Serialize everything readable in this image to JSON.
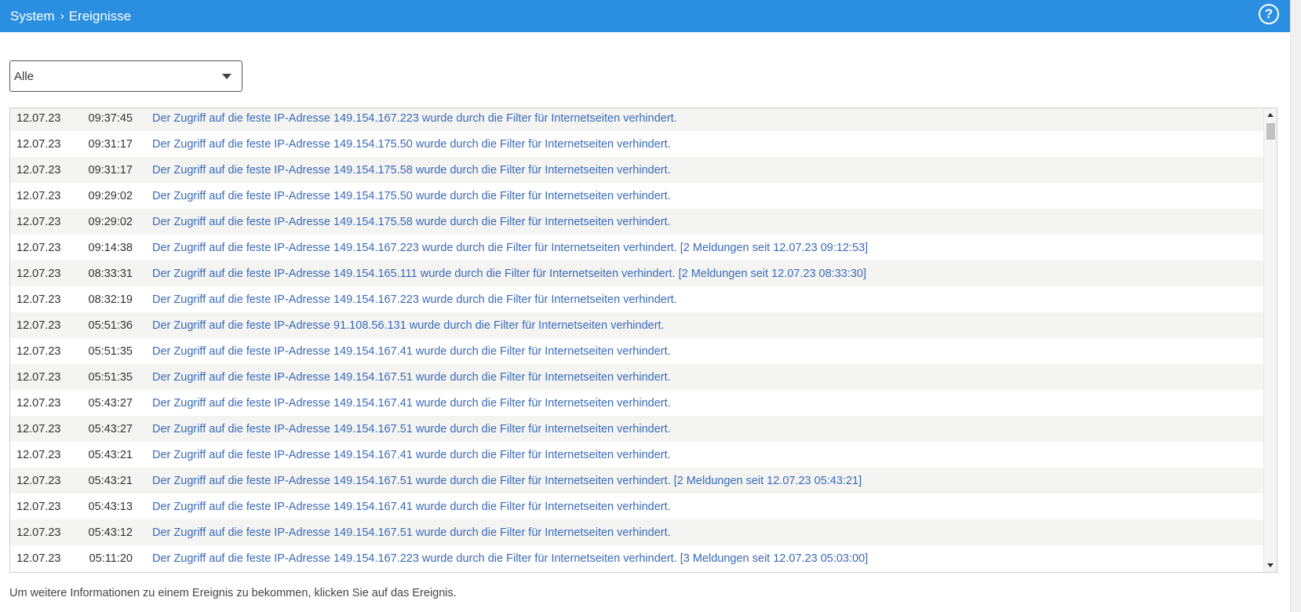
{
  "header": {
    "breadcrumb": [
      "System",
      "Ereignisse"
    ],
    "separator": "›",
    "help_label": "?"
  },
  "filter": {
    "selected": "Alle"
  },
  "events": [
    {
      "date": "12.07.23",
      "time": "09:37:45",
      "message": "Der Zugriff auf die feste IP-Adresse 149.154.167.223 wurde durch die Filter für Internetseiten verhindert."
    },
    {
      "date": "12.07.23",
      "time": "09:31:17",
      "message": "Der Zugriff auf die feste IP-Adresse 149.154.175.50 wurde durch die Filter für Internetseiten verhindert."
    },
    {
      "date": "12.07.23",
      "time": "09:31:17",
      "message": "Der Zugriff auf die feste IP-Adresse 149.154.175.58 wurde durch die Filter für Internetseiten verhindert."
    },
    {
      "date": "12.07.23",
      "time": "09:29:02",
      "message": "Der Zugriff auf die feste IP-Adresse 149.154.175.50 wurde durch die Filter für Internetseiten verhindert."
    },
    {
      "date": "12.07.23",
      "time": "09:29:02",
      "message": "Der Zugriff auf die feste IP-Adresse 149.154.175.58 wurde durch die Filter für Internetseiten verhindert."
    },
    {
      "date": "12.07.23",
      "time": "09:14:38",
      "message": "Der Zugriff auf die feste IP-Adresse 149.154.167.223 wurde durch die Filter für Internetseiten verhindert. [2 Meldungen seit 12.07.23 09:12:53]"
    },
    {
      "date": "12.07.23",
      "time": "08:33:31",
      "message": "Der Zugriff auf die feste IP-Adresse 149.154.165.111 wurde durch die Filter für Internetseiten verhindert. [2 Meldungen seit 12.07.23 08:33:30]"
    },
    {
      "date": "12.07.23",
      "time": "08:32:19",
      "message": "Der Zugriff auf die feste IP-Adresse 149.154.167.223 wurde durch die Filter für Internetseiten verhindert."
    },
    {
      "date": "12.07.23",
      "time": "05:51:36",
      "message": "Der Zugriff auf die feste IP-Adresse 91.108.56.131 wurde durch die Filter für Internetseiten verhindert."
    },
    {
      "date": "12.07.23",
      "time": "05:51:35",
      "message": "Der Zugriff auf die feste IP-Adresse 149.154.167.41 wurde durch die Filter für Internetseiten verhindert."
    },
    {
      "date": "12.07.23",
      "time": "05:51:35",
      "message": "Der Zugriff auf die feste IP-Adresse 149.154.167.51 wurde durch die Filter für Internetseiten verhindert."
    },
    {
      "date": "12.07.23",
      "time": "05:43:27",
      "message": "Der Zugriff auf die feste IP-Adresse 149.154.167.41 wurde durch die Filter für Internetseiten verhindert."
    },
    {
      "date": "12.07.23",
      "time": "05:43:27",
      "message": "Der Zugriff auf die feste IP-Adresse 149.154.167.51 wurde durch die Filter für Internetseiten verhindert."
    },
    {
      "date": "12.07.23",
      "time": "05:43:21",
      "message": "Der Zugriff auf die feste IP-Adresse 149.154.167.41 wurde durch die Filter für Internetseiten verhindert."
    },
    {
      "date": "12.07.23",
      "time": "05:43:21",
      "message": "Der Zugriff auf die feste IP-Adresse 149.154.167.51 wurde durch die Filter für Internetseiten verhindert. [2 Meldungen seit 12.07.23 05:43:21]"
    },
    {
      "date": "12.07.23",
      "time": "05:43:13",
      "message": "Der Zugriff auf die feste IP-Adresse 149.154.167.41 wurde durch die Filter für Internetseiten verhindert."
    },
    {
      "date": "12.07.23",
      "time": "05:43:12",
      "message": "Der Zugriff auf die feste IP-Adresse 149.154.167.51 wurde durch die Filter für Internetseiten verhindert."
    },
    {
      "date": "12.07.23",
      "time": "05:11:20",
      "message": "Der Zugriff auf die feste IP-Adresse 149.154.167.223 wurde durch die Filter für Internetseiten verhindert. [3 Meldungen seit 12.07.23 05:03:00]"
    }
  ],
  "hint": "Um weitere Informationen zu einem Ereignis zu bekommen, klicken Sie auf das Ereignis.",
  "colors": {
    "header_bg": "#2a8fe0",
    "message_link": "#3a6ab8",
    "row_alt": "#f4f4f3"
  }
}
